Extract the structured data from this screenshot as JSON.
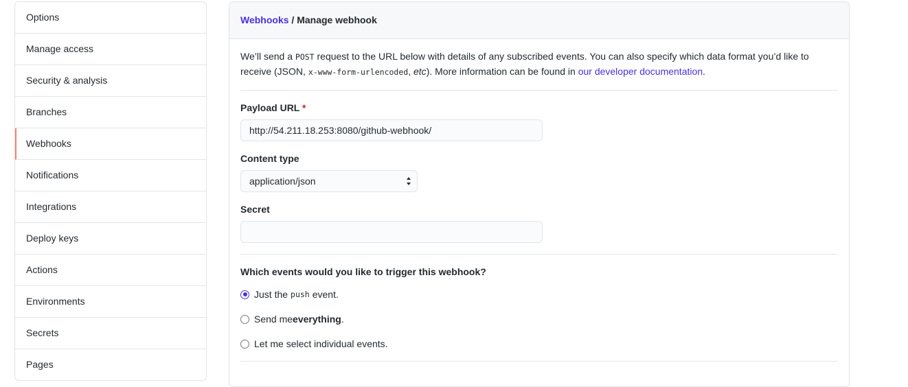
{
  "sidebar": {
    "items": [
      {
        "label": "Options"
      },
      {
        "label": "Manage access"
      },
      {
        "label": "Security & analysis"
      },
      {
        "label": "Branches"
      },
      {
        "label": "Webhooks"
      },
      {
        "label": "Notifications"
      },
      {
        "label": "Integrations"
      },
      {
        "label": "Deploy keys"
      },
      {
        "label": "Actions"
      },
      {
        "label": "Environments"
      },
      {
        "label": "Secrets"
      },
      {
        "label": "Pages"
      }
    ],
    "selected": "Webhooks"
  },
  "header": {
    "breadcrumb_link": "Webhooks",
    "separator": " / ",
    "current": "Manage webhook"
  },
  "intro": {
    "part1": "We’ll send a ",
    "code1": "POST",
    "part2": " request to the URL below with details of any subscribed events. You can also specify which data format you’d like to receive (JSON, ",
    "code2": "x-www-form-urlencoded",
    "part3": ", ",
    "etc": "etc",
    "part4": "). More information can be found in ",
    "link": "our developer documentation",
    "part5": "."
  },
  "form": {
    "payload_url_label": "Payload URL",
    "required_mark": "*",
    "payload_url_value": "http://54.211.18.253:8080/github-webhook/",
    "content_type_label": "Content type",
    "content_type_value": "application/json",
    "secret_label": "Secret",
    "secret_value": ""
  },
  "events": {
    "question": "Which events would you like to trigger this webhook?",
    "option1_pre": "Just the",
    "option1_code": "push",
    "option1_post": "event.",
    "option2_pre": "Send me ",
    "option2_bold": "everything",
    "option2_post": ".",
    "option3": "Let me select individual events.",
    "selected": "push"
  },
  "colors": {
    "accent": "#4a2fd9",
    "selected_indicator": "#f9826c",
    "required": "#cb2431",
    "border": "#e1e4e8"
  }
}
